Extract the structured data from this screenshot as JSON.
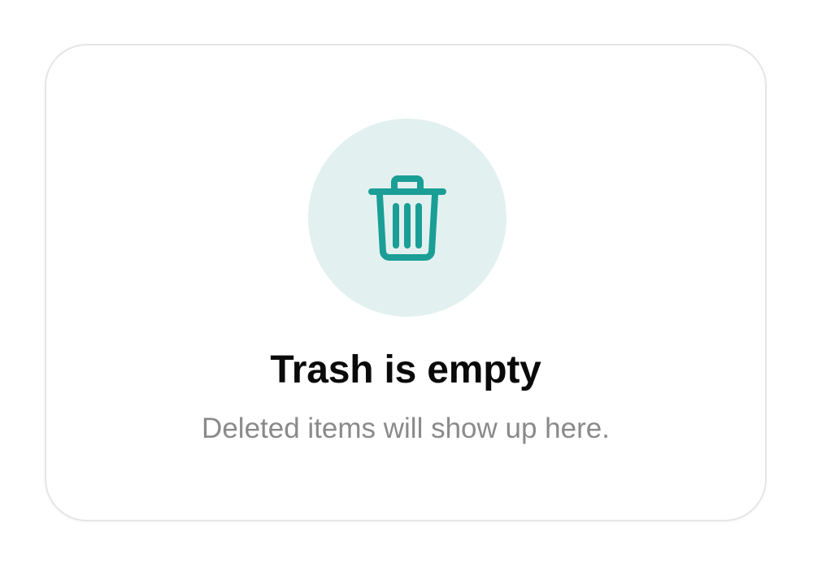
{
  "empty_state": {
    "icon": "trash-can-icon",
    "title": "Trash is empty",
    "message": "Deleted items will show up here."
  },
  "colors": {
    "accent": "#1a9e96",
    "icon_background": "#e2f1f0",
    "title_text": "#0a0a0a",
    "message_text": "#8a8a8a"
  }
}
